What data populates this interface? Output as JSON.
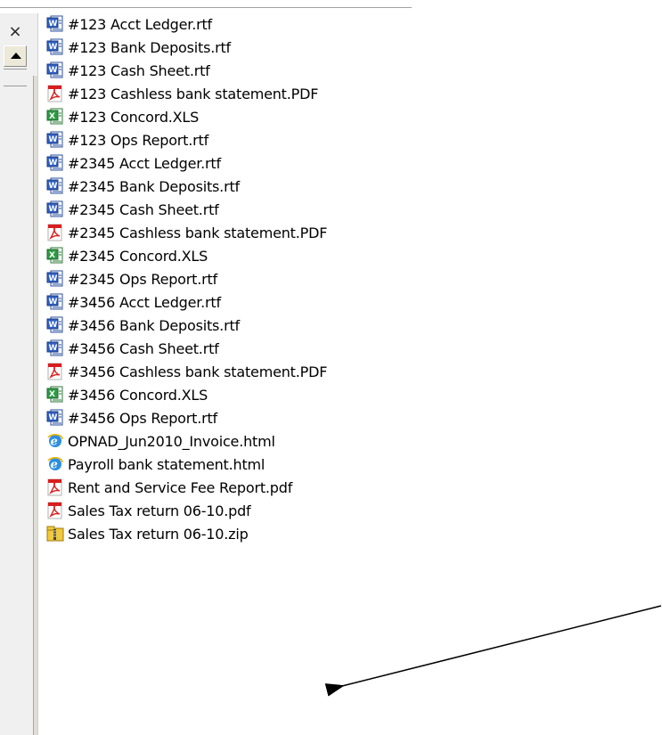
{
  "left_pane": {
    "close_glyph": "×"
  },
  "files": [
    {
      "name": "#123 Acct Ledger.rtf",
      "icon": "word-doc-icon"
    },
    {
      "name": "#123 Bank Deposits.rtf",
      "icon": "word-doc-icon"
    },
    {
      "name": "#123 Cash Sheet.rtf",
      "icon": "word-doc-icon"
    },
    {
      "name": "#123 Cashless bank statement.PDF",
      "icon": "pdf-icon"
    },
    {
      "name": "#123 Concord.XLS",
      "icon": "excel-icon"
    },
    {
      "name": "#123 Ops Report.rtf",
      "icon": "word-doc-icon"
    },
    {
      "name": "#2345 Acct Ledger.rtf",
      "icon": "word-doc-icon"
    },
    {
      "name": "#2345 Bank Deposits.rtf",
      "icon": "word-doc-icon"
    },
    {
      "name": "#2345 Cash Sheet.rtf",
      "icon": "word-doc-icon"
    },
    {
      "name": "#2345 Cashless bank statement.PDF",
      "icon": "pdf-icon"
    },
    {
      "name": "#2345 Concord.XLS",
      "icon": "excel-icon"
    },
    {
      "name": "#2345 Ops Report.rtf",
      "icon": "word-doc-icon"
    },
    {
      "name": "#3456 Acct Ledger.rtf",
      "icon": "word-doc-icon"
    },
    {
      "name": "#3456 Bank Deposits.rtf",
      "icon": "word-doc-icon"
    },
    {
      "name": "#3456 Cash Sheet.rtf",
      "icon": "word-doc-icon"
    },
    {
      "name": "#3456 Cashless bank statement.PDF",
      "icon": "pdf-icon"
    },
    {
      "name": "#3456 Concord.XLS",
      "icon": "excel-icon"
    },
    {
      "name": "#3456 Ops Report.rtf",
      "icon": "word-doc-icon"
    },
    {
      "name": "OPNAD_Jun2010_Invoice.html",
      "icon": "ie-html-icon"
    },
    {
      "name": "Payroll bank statement.html",
      "icon": "ie-html-icon"
    },
    {
      "name": "Rent and Service Fee Report.pdf",
      "icon": "pdf-icon"
    },
    {
      "name": "Sales Tax return 06-10.pdf",
      "icon": "pdf-icon"
    },
    {
      "name": "Sales Tax return 06-10.zip",
      "icon": "zip-folder-icon"
    }
  ],
  "annotation": {
    "arrow_color": "#000000",
    "points_to": "Sales Tax return 06-10.zip"
  }
}
